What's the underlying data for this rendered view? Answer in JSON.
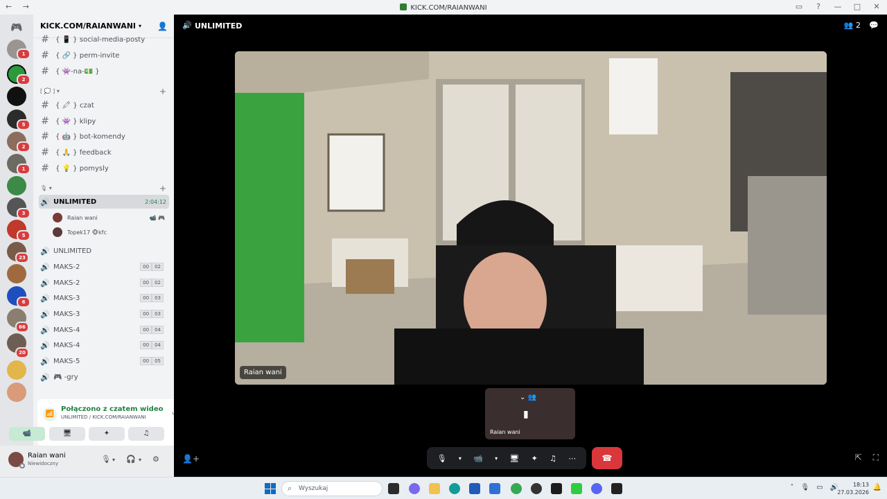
{
  "window": {
    "title": "KICK.COM/RAIANWANI"
  },
  "server": {
    "name": "KICK.COM/RAIANWANI"
  },
  "rail_badges": [
    "1",
    "2",
    "5",
    "2",
    "1",
    "3",
    "5",
    "23",
    "6",
    "66",
    "20"
  ],
  "channels": {
    "text_top": [
      {
        "emoji": "{ 📱 }",
        "label": "social-media-posty"
      },
      {
        "emoji": "{ 🔗 }",
        "label": "perm-invite"
      },
      {
        "emoji": "{ 👾-na-💵 }",
        "label": ""
      }
    ],
    "category1": "[ 💭 ]",
    "text_main": [
      {
        "emoji": "{ 🖍 }",
        "label": "czat"
      },
      {
        "emoji": "{ 👾 }",
        "label": "klipy"
      },
      {
        "emoji": "{ 🤖 }",
        "label": "bot-komendy"
      },
      {
        "emoji": "{ 🙏 }",
        "label": "feedback"
      },
      {
        "emoji": "{ 💡 }",
        "label": "pomysly"
      }
    ],
    "category2": "🎙",
    "active_voice": {
      "label": "UNLIMITED",
      "timer": "2:04:12"
    },
    "members": [
      {
        "name": "Raian wani",
        "extra": ""
      },
      {
        "name": "Topek17",
        "extra": "🐵kfc"
      }
    ],
    "voice": [
      {
        "label": "UNLIMITED",
        "a": "",
        "b": ""
      },
      {
        "label": "MAKS-2",
        "a": "00",
        "b": "02"
      },
      {
        "label": "MAKS-2",
        "a": "00",
        "b": "02"
      },
      {
        "label": "MAKS-3",
        "a": "00",
        "b": "03"
      },
      {
        "label": "MAKS-3",
        "a": "00",
        "b": "03"
      },
      {
        "label": "MAKS-4",
        "a": "00",
        "b": "04"
      },
      {
        "label": "MAKS-4",
        "a": "00",
        "b": "04"
      },
      {
        "label": "MAKS-5",
        "a": "00",
        "b": "05"
      },
      {
        "label": "🎮 -gry",
        "a": "",
        "b": ""
      }
    ]
  },
  "voice_panel": {
    "status": "Połączono z czatem wideo",
    "location": "UNLIMITED / KICK.COM/RAIANWANI"
  },
  "user": {
    "name": "Raian wani",
    "status": "Niewidoczny"
  },
  "call": {
    "channel": "UNLIMITED",
    "participants": "2",
    "main_name": "Raian wani",
    "thumb_name": "Raian wani"
  },
  "taskbar": {
    "search_placeholder": "Wyszukaj",
    "time": "18:13",
    "date": "27.03.2026"
  },
  "colors": {
    "accent_green": "#23a55a",
    "end_call": "#da373c",
    "badge_red": "#d83c3e"
  }
}
